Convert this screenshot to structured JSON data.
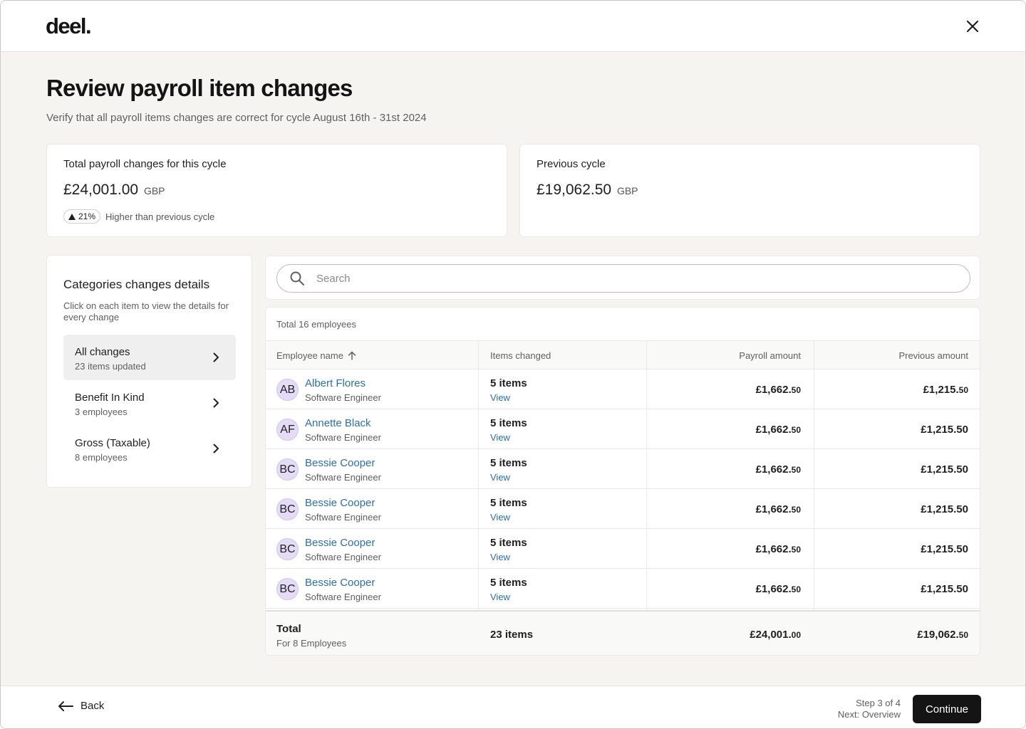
{
  "header": {
    "logo_text": "deel."
  },
  "page": {
    "title": "Review payroll item changes",
    "subtitle": "Verify that all payroll items changes are correct for cycle August 16th - 31st 2024"
  },
  "summary": {
    "current": {
      "label": "Total payroll changes for this cycle",
      "amount": "£24,001.00",
      "currency": "GBP",
      "badge": "21%",
      "badge_note": "Higher than previous cycle"
    },
    "previous": {
      "label": "Previous cycle",
      "amount": "£19,062.50",
      "currency": "GBP"
    }
  },
  "categories": {
    "title": "Categories changes details",
    "description": "Click on each item to view the details for every change",
    "items": [
      {
        "name": "All changes",
        "sub": "23 items updated",
        "active": true
      },
      {
        "name": "Benefit In Kind",
        "sub": "3 employees",
        "active": false
      },
      {
        "name": "Gross (Taxable)",
        "sub": "8 employees",
        "active": false
      }
    ]
  },
  "search": {
    "placeholder": "Search"
  },
  "table": {
    "total_count": "Total 16 employees",
    "headers": {
      "employee": "Employee name",
      "items": "Items changed",
      "payroll": "Payroll amount",
      "previous": "Previous amount"
    },
    "rows": [
      {
        "initials": "AB",
        "name": "Albert Flores",
        "role": "Software Engineer",
        "items": "5 items",
        "view": "View",
        "payroll_main": "£1,662.",
        "payroll_cents": "50",
        "prev_main": "£1,215.",
        "prev_cents": "50"
      },
      {
        "initials": "AF",
        "name": "Annette Black",
        "role": "Software Engineer",
        "items": "5 items",
        "view": "View",
        "payroll_main": "£1,662.",
        "payroll_cents": "50",
        "prev_main": "£1,215.50",
        "prev_cents": ""
      },
      {
        "initials": "BC",
        "name": "Bessie Cooper",
        "role": "Software Engineer",
        "items": "5 items",
        "view": "View",
        "payroll_main": "£1,662.",
        "payroll_cents": "50",
        "prev_main": "£1,215.50",
        "prev_cents": ""
      },
      {
        "initials": "BC",
        "name": "Bessie Cooper",
        "role": "Software Engineer",
        "items": "5 items",
        "view": "View",
        "payroll_main": "£1,662.",
        "payroll_cents": "50",
        "prev_main": "£1,215.50",
        "prev_cents": ""
      },
      {
        "initials": "BC",
        "name": "Bessie Cooper",
        "role": "Software Engineer",
        "items": "5 items",
        "view": "View",
        "payroll_main": "£1,662.",
        "payroll_cents": "50",
        "prev_main": "£1,215.50",
        "prev_cents": ""
      },
      {
        "initials": "BC",
        "name": "Bessie Cooper",
        "role": "Software Engineer",
        "items": "5 items",
        "view": "View",
        "payroll_main": "£1,662.",
        "payroll_cents": "50",
        "prev_main": "£1,215.50",
        "prev_cents": ""
      }
    ],
    "footer": {
      "label": "Total",
      "sub": "For 8 Employees",
      "items": "23 items",
      "payroll_main": "£24,001.",
      "payroll_cents": "00",
      "prev_main": "£19,062.",
      "prev_cents": "50"
    }
  },
  "footer": {
    "back_label": "Back",
    "step": "Step 3 of 4",
    "next": "Next: Overview",
    "continue_label": "Continue"
  },
  "colors": {
    "accent_link": "#2a6fb0",
    "primary_button": "#141414",
    "avatar_bg": "#e4dcf6"
  },
  "icons": [
    "close-icon",
    "triangle-up-icon",
    "chevron-right-icon",
    "search-icon",
    "arrow-up-icon",
    "arrow-left-icon"
  ]
}
